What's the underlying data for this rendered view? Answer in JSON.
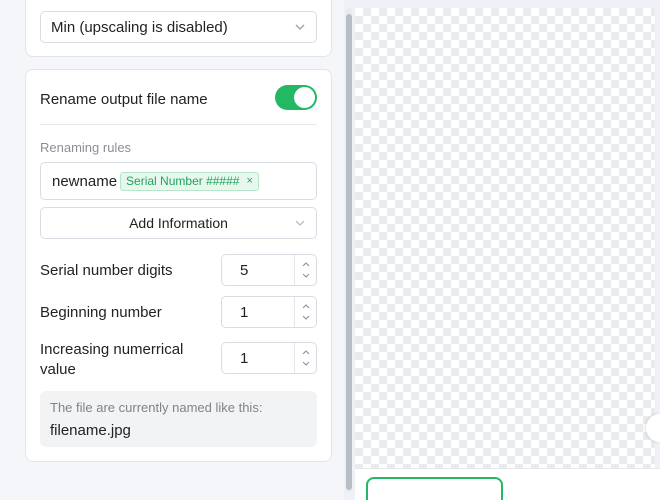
{
  "colors": {
    "accent": "#22b864",
    "tag_bg": "#e7f7ee",
    "muted_text": "#8a8f97"
  },
  "upscaling": {
    "selected_value": "Min (upscaling is disabled)",
    "icon": "chevron-down-icon"
  },
  "rename": {
    "toggle_label": "Rename output file name",
    "toggle_on": true,
    "rules_label": "Renaming rules",
    "input_text": "newname",
    "tag_label": "Serial Number #####",
    "tag_remove": "×",
    "add_info_label": "Add Information"
  },
  "serial_digits": {
    "label": "Serial number digits",
    "value": "5"
  },
  "beginning_number": {
    "label": "Beginning number",
    "value": "1"
  },
  "increasing_value": {
    "label": "Increasing numerrical value",
    "value": "1"
  },
  "preview": {
    "label": "The file are currently named like this:",
    "filename": "filename.jpg"
  }
}
